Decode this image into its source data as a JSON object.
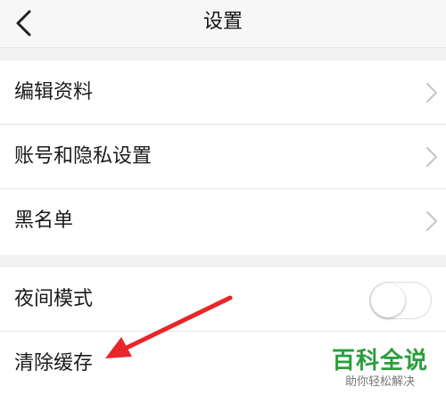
{
  "header": {
    "title": "设置",
    "back_icon": "chevron-left-icon"
  },
  "group1": {
    "items": [
      {
        "label": "编辑资料",
        "icon": "chevron-right-icon"
      },
      {
        "label": "账号和隐私设置",
        "icon": "chevron-right-icon"
      },
      {
        "label": "黑名单",
        "icon": "chevron-right-icon"
      }
    ]
  },
  "group2": {
    "items": [
      {
        "label": "夜间模式",
        "toggle_on": false
      },
      {
        "label": "清除缓存"
      }
    ]
  },
  "annotation": {
    "arrow_color": "#e8262a"
  },
  "watermark": {
    "main": "百科全说",
    "sub": "助你轻松解决",
    "color": "#2a9d3c"
  }
}
